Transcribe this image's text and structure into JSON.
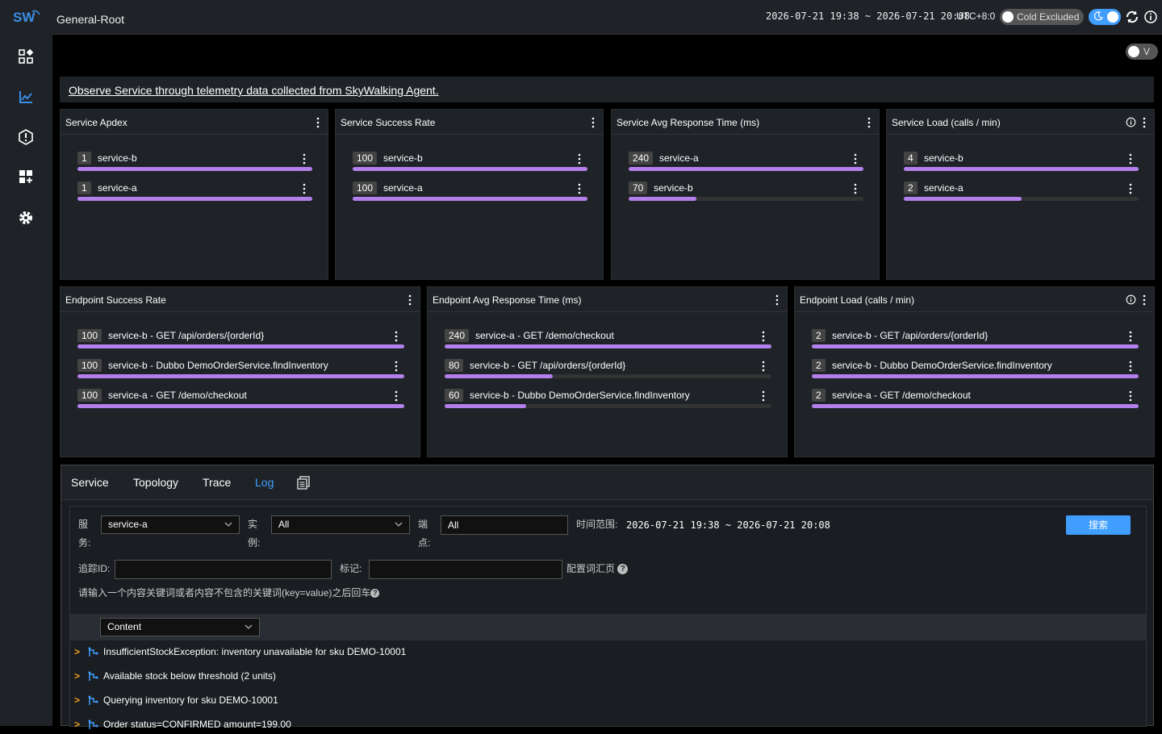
{
  "header": {
    "title": "General-Root",
    "time_range": "2026-07-21 19:38 ~ 2026-07-21 20:08",
    "timezone": "UTC+8:0",
    "cold_toggle": "Cold Excluded",
    "v_toggle": "V"
  },
  "intro": "Observe Service through telemetry data collected from SkyWalking Agent.",
  "widgets": [
    {
      "title": "Service Apdex",
      "rows": [
        {
          "value": "1",
          "label": "service-b",
          "fill": 100
        },
        {
          "value": "1",
          "label": "service-a",
          "fill": 100
        }
      ]
    },
    {
      "title": "Service Success Rate",
      "rows": [
        {
          "value": "100",
          "label": "service-b",
          "fill": 100
        },
        {
          "value": "100",
          "label": "service-a",
          "fill": 100
        }
      ]
    },
    {
      "title": "Service Avg Response Time (ms)",
      "rows": [
        {
          "value": "240",
          "label": "service-a",
          "fill": 100
        },
        {
          "value": "70",
          "label": "service-b",
          "fill": 29
        }
      ]
    },
    {
      "title": "Service Load (calls / min)",
      "rows": [
        {
          "value": "4",
          "label": "service-b",
          "fill": 100
        },
        {
          "value": "2",
          "label": "service-a",
          "fill": 50
        }
      ]
    },
    {
      "title": "Endpoint Success Rate",
      "rows": [
        {
          "value": "100",
          "label": "service-b - GET /api/orders/{orderId}",
          "fill": 100
        },
        {
          "value": "100",
          "label": "service-b - Dubbo DemoOrderService.findInventory",
          "fill": 100
        },
        {
          "value": "100",
          "label": "service-a - GET /demo/checkout",
          "fill": 100
        }
      ]
    },
    {
      "title": "Endpoint Avg Response Time (ms)",
      "rows": [
        {
          "value": "240",
          "label": "service-a - GET /demo/checkout",
          "fill": 100
        },
        {
          "value": "80",
          "label": "service-b - GET /api/orders/{orderId}",
          "fill": 33
        },
        {
          "value": "60",
          "label": "service-b - Dubbo DemoOrderService.findInventory",
          "fill": 25
        }
      ]
    },
    {
      "title": "Endpoint Load (calls / min)",
      "rows": [
        {
          "value": "2",
          "label": "service-b - GET /api/orders/{orderId}",
          "fill": 100
        },
        {
          "value": "2",
          "label": "service-b - Dubbo DemoOrderService.findInventory",
          "fill": 100
        },
        {
          "value": "2",
          "label": "service-a - GET /demo/checkout",
          "fill": 100
        }
      ]
    }
  ],
  "tabs": [
    "Service",
    "Topology",
    "Trace",
    "Log"
  ],
  "active_tab": "Log",
  "log": {
    "service_label_1": "服",
    "service_label_2": "务:",
    "service_value": "service-a",
    "instance_label_1": "实",
    "instance_label_2": "例:",
    "instance_value": "All",
    "endpoint_label_1": "端",
    "endpoint_label_2": "点:",
    "endpoint_value": "All",
    "time_label": "时间范围:",
    "time_value": "2026-07-21 19:38 ~ 2026-07-21 20:08",
    "search_button": "搜索",
    "trace_id_label": "追踪ID:",
    "trace_id_value": "",
    "tags_label": "标记:",
    "tags_value": "",
    "config_label": "配置词汇页",
    "hint": "请输入一个内容关键词或者内容不包含的关键词(key=value)之后回车",
    "content_select": "Content",
    "rows": [
      "InsufficientStockException: inventory unavailable for sku DEMO-10001",
      "Available stock below threshold (2 units)",
      "Querying inventory for sku DEMO-10001",
      "Order status=CONFIRMED amount=199.00"
    ]
  },
  "colors": {
    "accent": "#409eff",
    "bar_fill": "#b37feb",
    "arrow": "#f0a020"
  }
}
